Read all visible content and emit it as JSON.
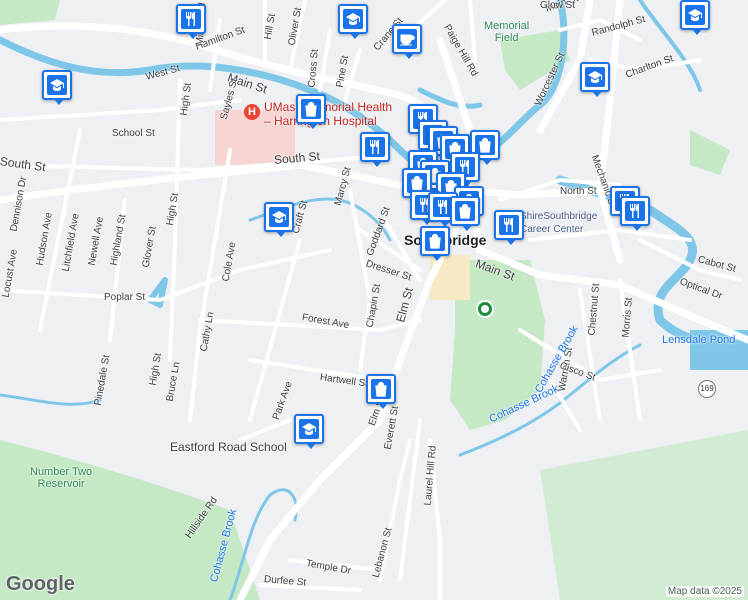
{
  "map": {
    "attribution": "Map data ©2025",
    "logo": "Google",
    "labels": {
      "memorial_field": "Memorial\nField",
      "hospital": "UMass Memorial Health – Harrington Hospital",
      "town": "Southbridge",
      "career": "ShireSouthbridge Career Center",
      "lensdale": "Lensdale Pond",
      "school": "Eastford Road School",
      "reservoir": "Number Two\nReservoir",
      "brook1": "Cohasse Brook",
      "brook2": "Cohasse Brook",
      "brook3": "Cohasse Brook",
      "hwy": "169"
    },
    "streets": [
      "Hamilton St",
      "Hill St",
      "Oliver St",
      "Mill St",
      "West St",
      "Main St",
      "Cross St",
      "Pine St",
      "Crane St",
      "Paige Hill Rd",
      "High St",
      "Sayles St",
      "School St",
      "South St",
      "South St",
      "Marcy St",
      "Craft St",
      "Goddard St",
      "Dresser St",
      "Chapin St",
      "Forest Ave",
      "Elm St",
      "Hartwell St",
      "Park Ave",
      "Cathy Ln",
      "Cole Ave",
      "Poplar St",
      "Glover St",
      "Highland St",
      "Newell Ave",
      "Litchfield Ave",
      "Hudson Ave",
      "Dennison Dr",
      "Locust Ave",
      "Pinedale St",
      "Bruce Ln",
      "High St",
      "High St",
      "Hillside Rd",
      "Temple Dr",
      "Durfee St",
      "Lebanon St",
      "Laurel Hill Rd",
      "Everett St",
      "Elm St",
      "Main St",
      "North St",
      "Worcester St",
      "Mechanic St",
      "Randolph St",
      "Charlton St",
      "Cabot St",
      "Optical Dr",
      "Chestnut St",
      "Morris St",
      "Warren St",
      "Cisco St",
      "Main St",
      "Mill St",
      "Glow St"
    ],
    "markers": [
      {
        "type": "restaurant"
      },
      {
        "type": "school"
      },
      {
        "type": "school"
      },
      {
        "type": "cafe"
      },
      {
        "type": "school"
      },
      {
        "type": "school"
      },
      {
        "type": "shopping"
      },
      {
        "type": "restaurant"
      },
      {
        "type": "restaurant"
      },
      {
        "type": "restaurant"
      },
      {
        "type": "shopping"
      },
      {
        "type": "shopping"
      },
      {
        "type": "shopping"
      },
      {
        "type": "shopping"
      },
      {
        "type": "shopping"
      },
      {
        "type": "restaurant"
      },
      {
        "type": "shopping"
      },
      {
        "type": "shopping"
      },
      {
        "type": "shopping"
      },
      {
        "type": "restaurant"
      },
      {
        "type": "restaurant"
      },
      {
        "type": "shopping"
      },
      {
        "type": "restaurant"
      },
      {
        "type": "restaurant"
      },
      {
        "type": "restaurant"
      },
      {
        "type": "school"
      },
      {
        "type": "shopping"
      },
      {
        "type": "school"
      },
      {
        "type": "shopping"
      }
    ],
    "colors": {
      "water": "#7fc7e8",
      "park": "#c6e9c5",
      "road": "#ffffff",
      "marker": "#1a73e8"
    }
  }
}
